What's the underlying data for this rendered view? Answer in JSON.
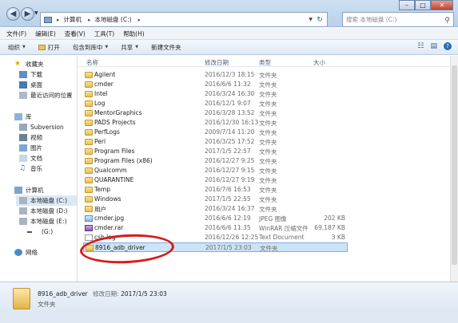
{
  "address": {
    "segments": [
      "计算机",
      "本地磁盘 (C:)"
    ]
  },
  "search": {
    "placeholder": "搜索 本地磁盘 (C:)"
  },
  "menu": [
    "文件(F)",
    "编辑(E)",
    "查看(V)",
    "工具(T)",
    "帮助(H)"
  ],
  "toolbar": {
    "organize": "组织",
    "open": "打开",
    "include_in_library": "包含到库中",
    "share": "共享",
    "new_folder": "新建文件夹"
  },
  "sidebar": {
    "favorites": "收藏夹",
    "downloads": "下载",
    "desktop": "桌面",
    "recent": "最近访问的位置",
    "libraries": "库",
    "subversion": "Subversion",
    "videos": "视频",
    "pictures": "图片",
    "documents": "文档",
    "music": "音乐",
    "computer": "计算机",
    "drive_c": "本地磁盘 (C:)",
    "drive_d": "本地磁盘 (D:)",
    "drive_e": "本地磁盘 (E:)",
    "drive_g": "(G:)",
    "network": "网络"
  },
  "columns": {
    "name": "名称",
    "date": "修改日期",
    "type": "类型",
    "size": "大小"
  },
  "files": [
    {
      "name": "Agilent",
      "date": "2016/12/3 18:15",
      "type": "文件夹",
      "size": "",
      "icon": "folder"
    },
    {
      "name": "cmder",
      "date": "2016/6/6 11:32",
      "type": "文件夹",
      "size": "",
      "icon": "folder"
    },
    {
      "name": "Intel",
      "date": "2016/3/24 16:30",
      "type": "文件夹",
      "size": "",
      "icon": "folder"
    },
    {
      "name": "Log",
      "date": "2016/12/1 9:07",
      "type": "文件夹",
      "size": "",
      "icon": "folder"
    },
    {
      "name": "MentorGraphics",
      "date": "2016/3/28 13:52",
      "type": "文件夹",
      "size": "",
      "icon": "folder"
    },
    {
      "name": "PADS Projects",
      "date": "2016/12/30 16:13",
      "type": "文件夹",
      "size": "",
      "icon": "folder"
    },
    {
      "name": "PerfLogs",
      "date": "2009/7/14 11:20",
      "type": "文件夹",
      "size": "",
      "icon": "folder"
    },
    {
      "name": "Perl",
      "date": "2016/3/25 17:52",
      "type": "文件夹",
      "size": "",
      "icon": "folder"
    },
    {
      "name": "Program Files",
      "date": "2017/1/5 22:57",
      "type": "文件夹",
      "size": "",
      "icon": "folder"
    },
    {
      "name": "Program Files (x86)",
      "date": "2016/12/27 9:25",
      "type": "文件夹",
      "size": "",
      "icon": "folder"
    },
    {
      "name": "Qualcomm",
      "date": "2016/12/27 9:15",
      "type": "文件夹",
      "size": "",
      "icon": "folder"
    },
    {
      "name": "QUARANTINE",
      "date": "2016/12/27 9:19",
      "type": "文件夹",
      "size": "",
      "icon": "folder"
    },
    {
      "name": "Temp",
      "date": "2016/7/6 16:53",
      "type": "文件夹",
      "size": "",
      "icon": "folder"
    },
    {
      "name": "Windows",
      "date": "2017/1/5 22:55",
      "type": "文件夹",
      "size": "",
      "icon": "folder"
    },
    {
      "name": "用户",
      "date": "2016/3/24 16:37",
      "type": "文件夹",
      "size": "",
      "icon": "folder"
    },
    {
      "name": "cmder.jpg",
      "date": "2016/6/6 12:19",
      "type": "JPEG 图像",
      "size": "202 KB",
      "icon": "jpg"
    },
    {
      "name": "cmder.rar",
      "date": "2016/6/6 11:35",
      "type": "WinRAR 压缩文件",
      "size": "69,187 KB",
      "icon": "rar"
    },
    {
      "name": "csb.log",
      "date": "2016/12/26 12:25",
      "type": "Text Document",
      "size": "3 KB",
      "icon": "doc"
    },
    {
      "name": "8916_adb_driver",
      "date": "2017/1/5 23:03",
      "type": "文件夹",
      "size": "",
      "icon": "folder",
      "selected": true
    }
  ],
  "details": {
    "name": "8916_adb_driver",
    "modified_label": "修改日期:",
    "modified_value": "2017/1/5 23:03",
    "type": "文件夹"
  },
  "colors": {
    "selection": "#cce4f7",
    "annotation": "#d71a1a"
  }
}
